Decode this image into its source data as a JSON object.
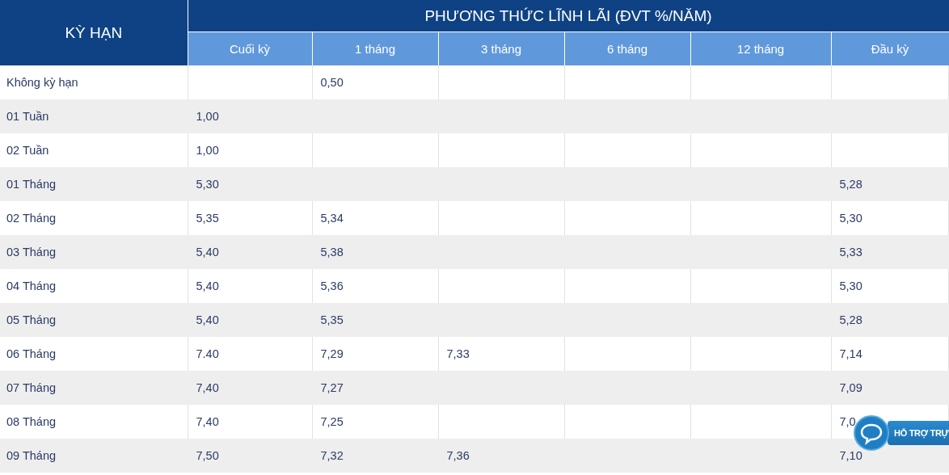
{
  "table": {
    "term_header": "KỲ HẠN",
    "group_header": "PHƯƠNG THỨC LĨNH LÃI (ĐVT %/NĂM)",
    "columns": [
      "Cuối kỳ",
      "1 tháng",
      "3 tháng",
      "6 tháng",
      "12 tháng",
      "Đầu kỳ"
    ],
    "rows": [
      {
        "term": "Không kỳ hạn",
        "rates": {
          "m1": "0,50"
        }
      },
      {
        "term": "01 Tuần",
        "rates": {
          "cuoi_ky": "1,00"
        }
      },
      {
        "term": "02 Tuần",
        "rates": {
          "cuoi_ky": "1,00"
        }
      },
      {
        "term": "01 Tháng",
        "rates": {
          "cuoi_ky": "5,30",
          "dau_ky": "5,28"
        }
      },
      {
        "term": "02 Tháng",
        "rates": {
          "cuoi_ky": "5,35",
          "m1": "5,34",
          "dau_ky": "5,30"
        }
      },
      {
        "term": "03 Tháng",
        "rates": {
          "cuoi_ky": "5,40",
          "m1": "5,38",
          "dau_ky": "5,33"
        }
      },
      {
        "term": "04 Tháng",
        "rates": {
          "cuoi_ky": "5,40",
          "m1": "5,36",
          "dau_ky": "5,30"
        }
      },
      {
        "term": "05 Tháng",
        "rates": {
          "cuoi_ky": "5,40",
          "m1": "5,35",
          "dau_ky": "5,28"
        }
      },
      {
        "term": "06 Tháng",
        "rates": {
          "cuoi_ky": "7.40",
          "m1": "7,29",
          "m3": "7,33",
          "dau_ky": "7,14"
        }
      },
      {
        "term": "07 Tháng",
        "rates": {
          "cuoi_ky": "7,40",
          "m1": "7,27",
          "dau_ky": "7,09"
        }
      },
      {
        "term": "08 Tháng",
        "rates": {
          "cuoi_ky": "7,40",
          "m1": "7,25",
          "dau_ky": "7,0"
        }
      },
      {
        "term": "09 Tháng",
        "rates": {
          "cuoi_ky": "7,50",
          "m1": "7,32",
          "m3": "7,36",
          "dau_ky": "7,10"
        }
      }
    ]
  },
  "support_button": {
    "label": "HỖ TRỢ TRỰ"
  }
}
